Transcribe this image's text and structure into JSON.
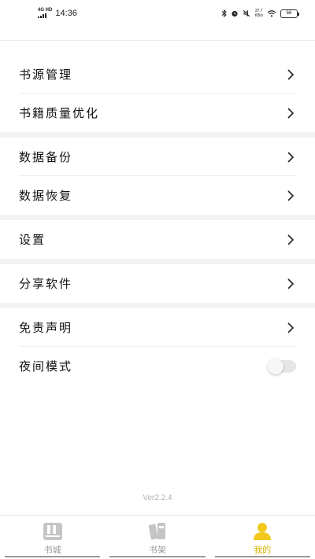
{
  "status_bar": {
    "network": "4G HD",
    "time": "14:36",
    "speed_value": "37.7",
    "speed_unit": "KB/s",
    "battery": "66"
  },
  "menu": {
    "items": [
      {
        "label": "书源管理",
        "type": "link"
      },
      {
        "label": "书籍质量优化",
        "type": "link"
      },
      {
        "label": "数据备份",
        "type": "link"
      },
      {
        "label": "数据恢复",
        "type": "link"
      },
      {
        "label": "设置",
        "type": "link"
      },
      {
        "label": "分享软件",
        "type": "link"
      },
      {
        "label": "免责声明",
        "type": "link"
      },
      {
        "label": "夜间模式",
        "type": "toggle",
        "enabled": false
      }
    ]
  },
  "version": "Ver2.2.4",
  "bottom_nav": {
    "items": [
      {
        "label": "书城",
        "icon": "book-city-icon",
        "active": false
      },
      {
        "label": "书架",
        "icon": "bookshelf-icon",
        "active": false
      },
      {
        "label": "我的",
        "icon": "profile-icon",
        "active": true
      }
    ]
  },
  "colors": {
    "accent": "#f2c81c",
    "divider": "#f3f3f3"
  }
}
